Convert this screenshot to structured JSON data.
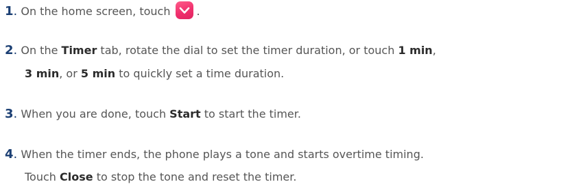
{
  "steps": [
    {
      "number": "1",
      "text_before": "On the home screen, touch",
      "icon": "clock-app-icon",
      "text_after": "."
    },
    {
      "number": "2",
      "l1_a": "On the ",
      "l1_b": "Timer",
      "l1_c": " tab, rotate the dial to set the timer duration, or touch ",
      "l1_d": "1 min",
      "l1_e": ",",
      "l2_a": "3 min",
      "l2_b": ", or ",
      "l2_c": "5 min",
      "l2_d": " to quickly set a time duration."
    },
    {
      "number": "3",
      "a": "When you are done, touch ",
      "b": "Start",
      "c": " to start the timer."
    },
    {
      "number": "4",
      "l1": "When the timer ends, the phone plays a tone and starts overtime timing.",
      "l2_a": "Touch ",
      "l2_b": "Close",
      "l2_c": " to stop the tone and reset the timer."
    }
  ],
  "colors": {
    "step_number": "#1b3f73",
    "body_text": "#555555",
    "bold_text": "#2b2b2b",
    "icon_background": "#f0306d"
  }
}
